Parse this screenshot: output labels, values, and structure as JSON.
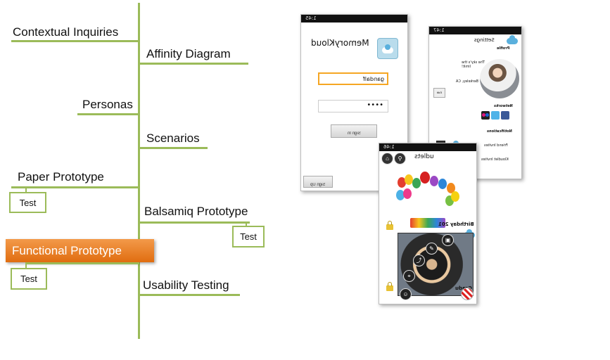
{
  "timeline": {
    "stages": [
      {
        "label": "Contextual  Inquiries"
      },
      {
        "label": "Affinity Diagram"
      },
      {
        "label": "Personas"
      },
      {
        "label": "Scenarios"
      },
      {
        "label": "Paper Prototype"
      },
      {
        "label": "Balsamiq Prototype"
      },
      {
        "label": "Functional Prototype",
        "highlighted": true
      },
      {
        "label": "Usability Testing"
      }
    ],
    "test_label": "Test",
    "colors": {
      "line": "#9bbb59",
      "highlight": "#e8761b",
      "highlight_text": "#ffffff"
    }
  },
  "phone_login": {
    "status_time": "1:45",
    "app_name": "MemoryKloud",
    "username_value": "gandalf",
    "password_value": "••••",
    "sign_in_label": "Sign In",
    "sign_up_label": "Sign Up"
  },
  "phone_settings": {
    "status_time": "1:47",
    "title": "Settings",
    "profile_label": "Profile",
    "quote": "The sky's the limit!",
    "location": "Berkeley, CA",
    "edit_label": "Edit",
    "networks_label": "Networks",
    "notifications_label": "Notifications",
    "notifications": [
      {
        "label": "Friend Invites"
      },
      {
        "label": "Kloudlet Invites"
      }
    ]
  },
  "phone_kloudlets": {
    "status_time": "1:46",
    "title_fragment": "udlets",
    "items": [
      {
        "label": "Birthday 201"
      },
      {
        "label": "Gradu"
      }
    ]
  }
}
